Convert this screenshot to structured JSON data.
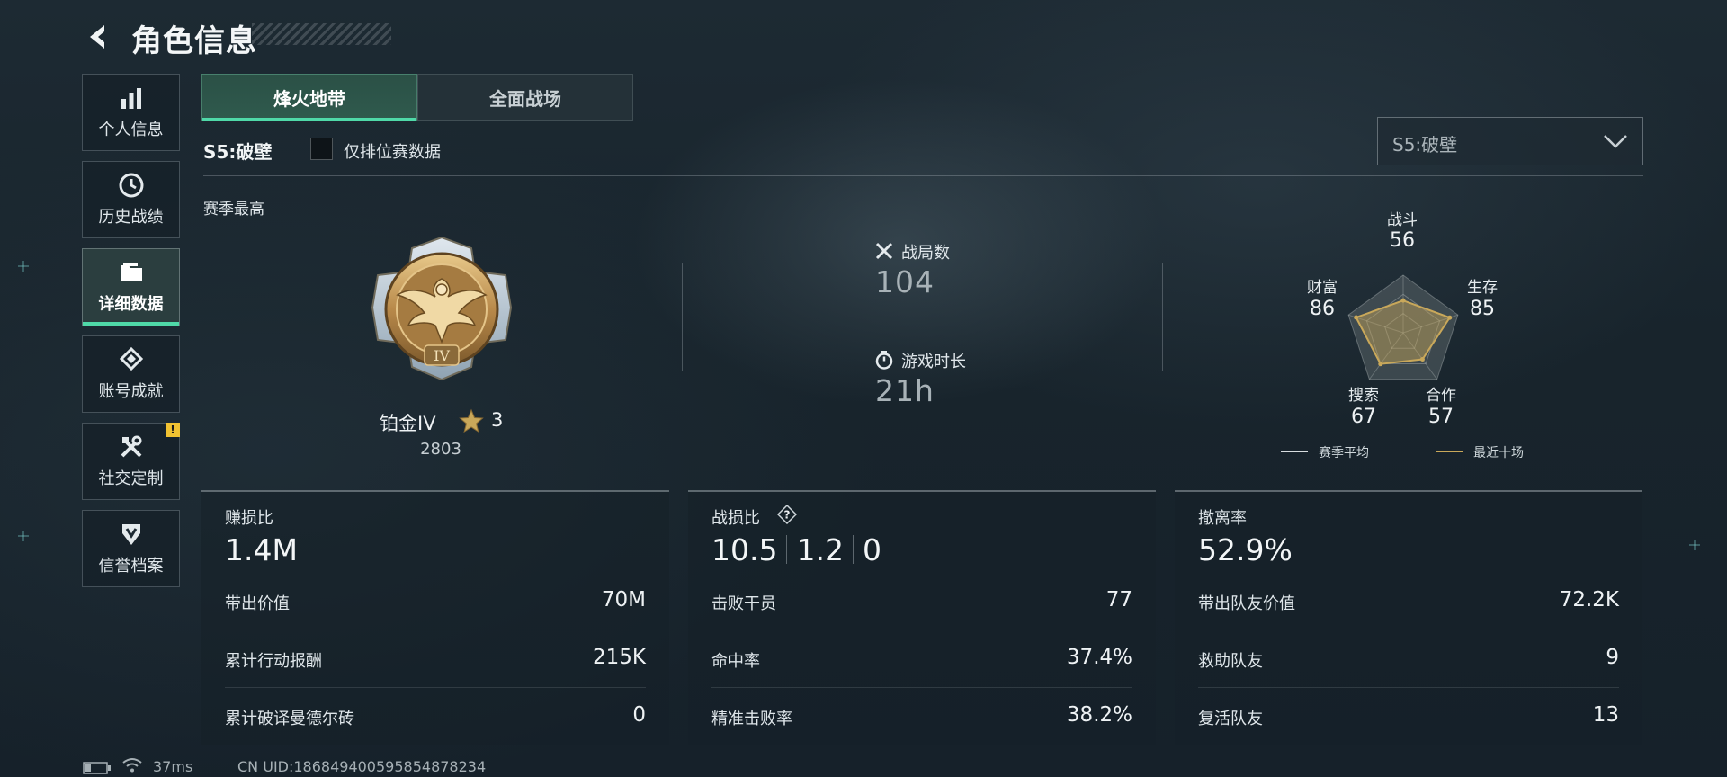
{
  "header": {
    "title": "角色信息"
  },
  "sidebar": {
    "items": [
      {
        "label": "个人信息",
        "icon": "bar-chart-icon"
      },
      {
        "label": "历史战绩",
        "icon": "history-clock-icon"
      },
      {
        "label": "详细数据",
        "icon": "folder-icon",
        "active": true
      },
      {
        "label": "账号成就",
        "icon": "achievement-icon"
      },
      {
        "label": "社交定制",
        "icon": "tools-icon",
        "badge": "!"
      },
      {
        "label": "信誉档案",
        "icon": "shield-icon"
      }
    ]
  },
  "tabs": [
    {
      "label": "烽火地带",
      "active": true
    },
    {
      "label": "全面战场",
      "active": false
    }
  ],
  "season": {
    "label": "S5:破壁",
    "ranked_only_label": "仅排位赛数据",
    "select_value": "S5:破壁"
  },
  "season_high": {
    "label": "赛季最高",
    "rank_name": "铂金IV",
    "rank_stars": "3",
    "rank_points": "2803",
    "medal_numeral": "IV"
  },
  "overview": {
    "matches_label": "战局数",
    "matches_value": "104",
    "playtime_label": "游戏时长",
    "playtime_value": "21h"
  },
  "radar": {
    "axes": [
      {
        "label": "战斗",
        "value": "56"
      },
      {
        "label": "生存",
        "value": "85"
      },
      {
        "label": "合作",
        "value": "57"
      },
      {
        "label": "搜索",
        "value": "67"
      },
      {
        "label": "财富",
        "value": "86"
      }
    ],
    "legend": {
      "season_avg": "赛季平均",
      "recent_ten": "最近十场"
    },
    "colors": {
      "season_avg": "#d8dde0",
      "recent_ten": "#c9a85a"
    }
  },
  "panels": {
    "profit": {
      "title": "赚损比",
      "big_value": "1.4M",
      "rows": [
        {
          "k": "带出价值",
          "v": "70M"
        },
        {
          "k": "累计行动报酬",
          "v": "215K"
        },
        {
          "k": "累计破译曼德尔砖",
          "v": "0"
        }
      ]
    },
    "combat": {
      "title": "战损比",
      "ratio": [
        "10.5",
        "1.2",
        "0"
      ],
      "rows": [
        {
          "k": "击败干员",
          "v": "77"
        },
        {
          "k": "命中率",
          "v": "37.4%"
        },
        {
          "k": "精准击败率",
          "v": "38.2%"
        }
      ]
    },
    "extract": {
      "title": "撤离率",
      "big_value": "52.9%",
      "rows": [
        {
          "k": "带出队友价值",
          "v": "72.2K"
        },
        {
          "k": "救助队友",
          "v": "9"
        },
        {
          "k": "复活队友",
          "v": "13"
        }
      ]
    }
  },
  "footer": {
    "ping": "37ms",
    "uid": "CN UID:18684940059585487823​4"
  },
  "colors": {
    "accent": "#4fd9a8",
    "gold": "#c9a85a",
    "badge": "#f1c232"
  }
}
